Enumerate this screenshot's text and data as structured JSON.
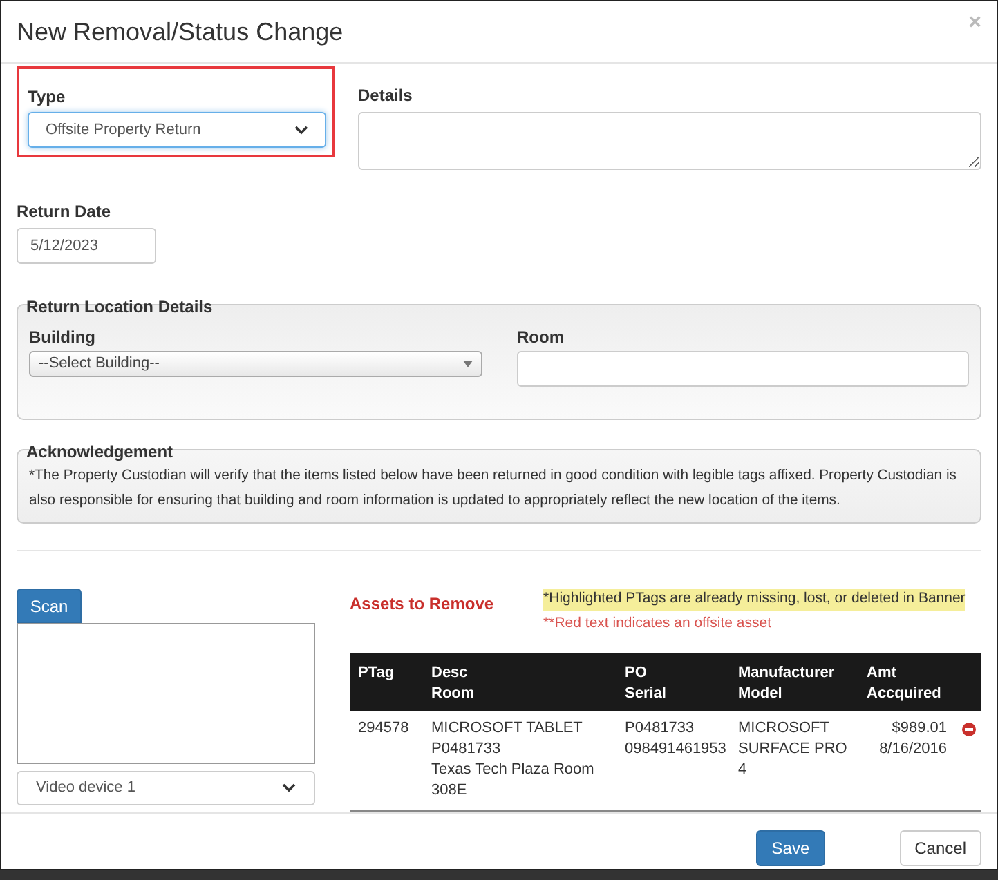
{
  "dialog": {
    "title": "New Removal/Status Change",
    "close": "×"
  },
  "type_field": {
    "label": "Type",
    "value": "Offsite Property Return",
    "highlighted": true
  },
  "details_field": {
    "label": "Details"
  },
  "return_date": {
    "label": "Return Date",
    "value": "5/12/2023"
  },
  "return_location": {
    "legend": "Return Location Details",
    "building_label": "Building",
    "building_value": "--Select Building--",
    "room_label": "Room"
  },
  "acknowledgement": {
    "legend": "Acknowledgement",
    "text": "*The Property Custodian will verify that the items listed below have been returned in good condition with legible tags affixed. Property Custodian is also responsible for ensuring that building and room information is updated to appropriately reflect the new location of the items."
  },
  "scan": {
    "button": "Scan",
    "device": "Video device 1"
  },
  "assets": {
    "title": "Assets to Remove",
    "note_highlight": "*Highlighted PTags are already missing, lost, or deleted in Banner",
    "note_red": "**Red text indicates an offsite asset",
    "columns": [
      [
        "PTag"
      ],
      [
        "Desc",
        "Room"
      ],
      [
        "PO",
        "Serial"
      ],
      [
        "Manufacturer",
        "Model"
      ],
      [
        "Amt",
        "Accquired"
      ]
    ],
    "rows": [
      {
        "ptag": "294578",
        "desc": "MICROSOFT TABLET P0481733",
        "room": "Texas Tech Plaza Room 308E",
        "po": "P0481733",
        "serial": "098491461953",
        "manufacturer": "MICROSOFT",
        "model": "SURFACE PRO 4",
        "amount": "$989.01",
        "acquired": "8/16/2016",
        "highlighted": false,
        "offsite": false
      }
    ]
  },
  "footer": {
    "save": "Save",
    "cancel": "Cancel"
  }
}
